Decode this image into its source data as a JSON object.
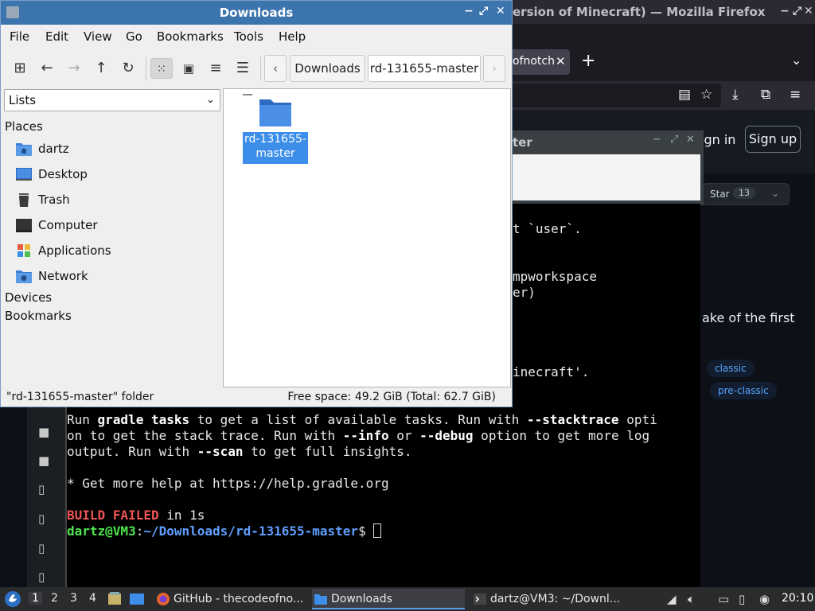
{
  "firefox": {
    "title": "ersion of Minecraft) — Mozilla Firefox",
    "tab_label": "ofnotch",
    "new_tab": "+",
    "window_controls": [
      "−",
      "⤢",
      "✕"
    ]
  },
  "github": {
    "sign_in": "ign in",
    "sign_up": "Sign up",
    "star_label": "Star",
    "star_count": "13",
    "description": "ake of the first",
    "topics": [
      "classic",
      "pre-classic"
    ]
  },
  "editor": {
    "title": "ter"
  },
  "terminal": {
    "lines_fragments": [
      "t `user`.",
      "mpworkspace",
      "er)",
      "inecraft'."
    ],
    "run_line_1": [
      "Run ",
      "gradle tasks",
      " to get a list of available tasks. Run with ",
      "--stacktrace",
      " opti"
    ],
    "run_line_2": [
      "on to get the stack trace. Run with ",
      "--info",
      " or ",
      "--debug",
      " option to get more log"
    ],
    "run_line_3": [
      "output. Run with ",
      "--scan",
      " to get full insights."
    ],
    "help_line": "* Get more help at https://help.gradle.org",
    "build_failed": "BUILD FAILED",
    "build_time": " in 1s",
    "prompt_user": "dartz@VM3",
    "prompt_colon": ":",
    "prompt_path": "~/Downloads/rd-131655-master",
    "prompt_symbol": "$ "
  },
  "file_manager": {
    "title": "Downloads",
    "window_controls": [
      "−",
      "⤢",
      "✕"
    ],
    "menu": [
      "File",
      "Edit",
      "View",
      "Go",
      "Bookmarks",
      "Tools",
      "Help"
    ],
    "breadcrumbs": [
      "Downloads",
      "rd-131655-master"
    ],
    "side_pane_select": "Lists",
    "places_heading": "Places",
    "places": [
      {
        "label": "dartz",
        "icon": "home-folder-icon"
      },
      {
        "label": "Desktop",
        "icon": "desktop-icon"
      },
      {
        "label": "Trash",
        "icon": "trash-icon"
      },
      {
        "label": "Computer",
        "icon": "computer-icon"
      },
      {
        "label": "Applications",
        "icon": "applications-icon"
      },
      {
        "label": "Network",
        "icon": "network-icon"
      }
    ],
    "devices_heading": "Devices",
    "bookmarks_heading": "Bookmarks",
    "items": [
      {
        "name_line1": "rd-131655-",
        "name_line2": "master",
        "type": "folder",
        "selected": true
      }
    ],
    "status_left": "\"rd-131655-master\" folder",
    "status_right": "Free space: 49.2 GiB (Total: 62.7 GiB)",
    "accent": "#3c74ad",
    "selection_color": "#3d8ee8"
  },
  "taskbar": {
    "workspaces": [
      "1",
      "2",
      "3",
      "4"
    ],
    "current_workspace": "1",
    "tasks": [
      {
        "label": "GitHub - thecodeofno...",
        "icon": "firefox-icon",
        "active": false
      },
      {
        "label": "Downloads",
        "icon": "folder-icon",
        "active": true
      },
      {
        "label": "dartz@VM3: ~/Downl...",
        "icon": "terminal-icon",
        "active": false
      }
    ],
    "clock": "20:10"
  }
}
